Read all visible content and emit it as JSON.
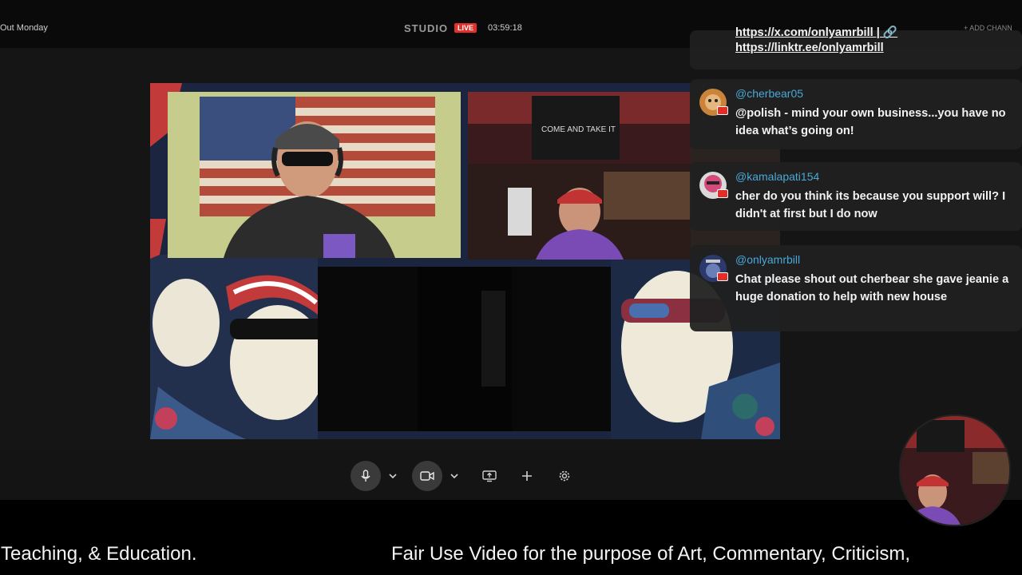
{
  "header": {
    "show_title": "Out Monday",
    "studio_label": "STUDIO",
    "live_badge": "LIVE",
    "elapsed_time": "03:59:18",
    "add_channel": "+ ADD CHANN"
  },
  "chat": {
    "pinned_links": [
      "https://x.com/onlyamrbill | 🔗",
      "https://linktr.ee/onlyamrbill"
    ],
    "messages": [
      {
        "user": "@cherbear05",
        "text": "@polish - mind your own business...you have no idea what’s going on!",
        "avatar_color": "#c9843a"
      },
      {
        "user": "@kamalapati154",
        "text": "cher do you think its because you support will? I didn't at first but I do now",
        "avatar_color": "#d44a7c"
      },
      {
        "user": "@onlyamrbill",
        "text": "Chat please shout out cherbear she gave jeanie a huge donation to help with new house",
        "avatar_color": "#2b3a6a"
      }
    ]
  },
  "stage": {
    "host_banner_text": "COME AND TAKE IT"
  },
  "controls": {
    "icons": [
      "microphone-icon",
      "chevron-down-icon",
      "camera-icon",
      "chevron-down-icon",
      "share-screen-icon",
      "plus-icon",
      "gear-icon"
    ]
  },
  "ticker": {
    "segment_left": "Teaching, & Education.",
    "segment_right": "Fair Use Video for the purpose of Art, Commentary, Criticism,"
  },
  "colors": {
    "live_red": "#e0312b",
    "username_blue": "#4aa8d8",
    "youtube_red": "#e52d27"
  }
}
